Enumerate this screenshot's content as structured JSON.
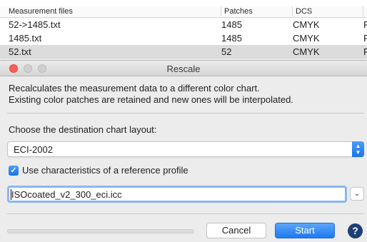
{
  "background_table": {
    "columns": [
      "Measurement files",
      "Patches",
      "DCS"
    ],
    "rows": [
      {
        "file": "52->1485.txt",
        "patches": "1485",
        "dcs": "CMYK",
        "extra": "F",
        "selected": false
      },
      {
        "file": "1485.txt",
        "patches": "1485",
        "dcs": "CMYK",
        "extra": "F",
        "selected": false
      },
      {
        "file": "52.txt",
        "patches": "52",
        "dcs": "CMYK",
        "extra": "F",
        "selected": true
      }
    ]
  },
  "dialog": {
    "title": "Rescale",
    "description_line1": "Recalculates the measurement data to a different color chart.",
    "description_line2": "Existing color patches are retained and new ones will be interpolated.",
    "layout_label": "Choose the destination chart layout:",
    "layout_selected": "ECI-2002",
    "use_reference_label": "Use characteristics of a reference profile",
    "use_reference_checked": true,
    "reference_profile": "ISOcoated_v2_300_eci.icc",
    "progress": 0,
    "cancel_label": "Cancel",
    "start_label": "Start",
    "help_label": "?"
  },
  "colors": {
    "accent": "#1a73ea",
    "close": "#fc5f57",
    "help": "#1d3f74"
  }
}
